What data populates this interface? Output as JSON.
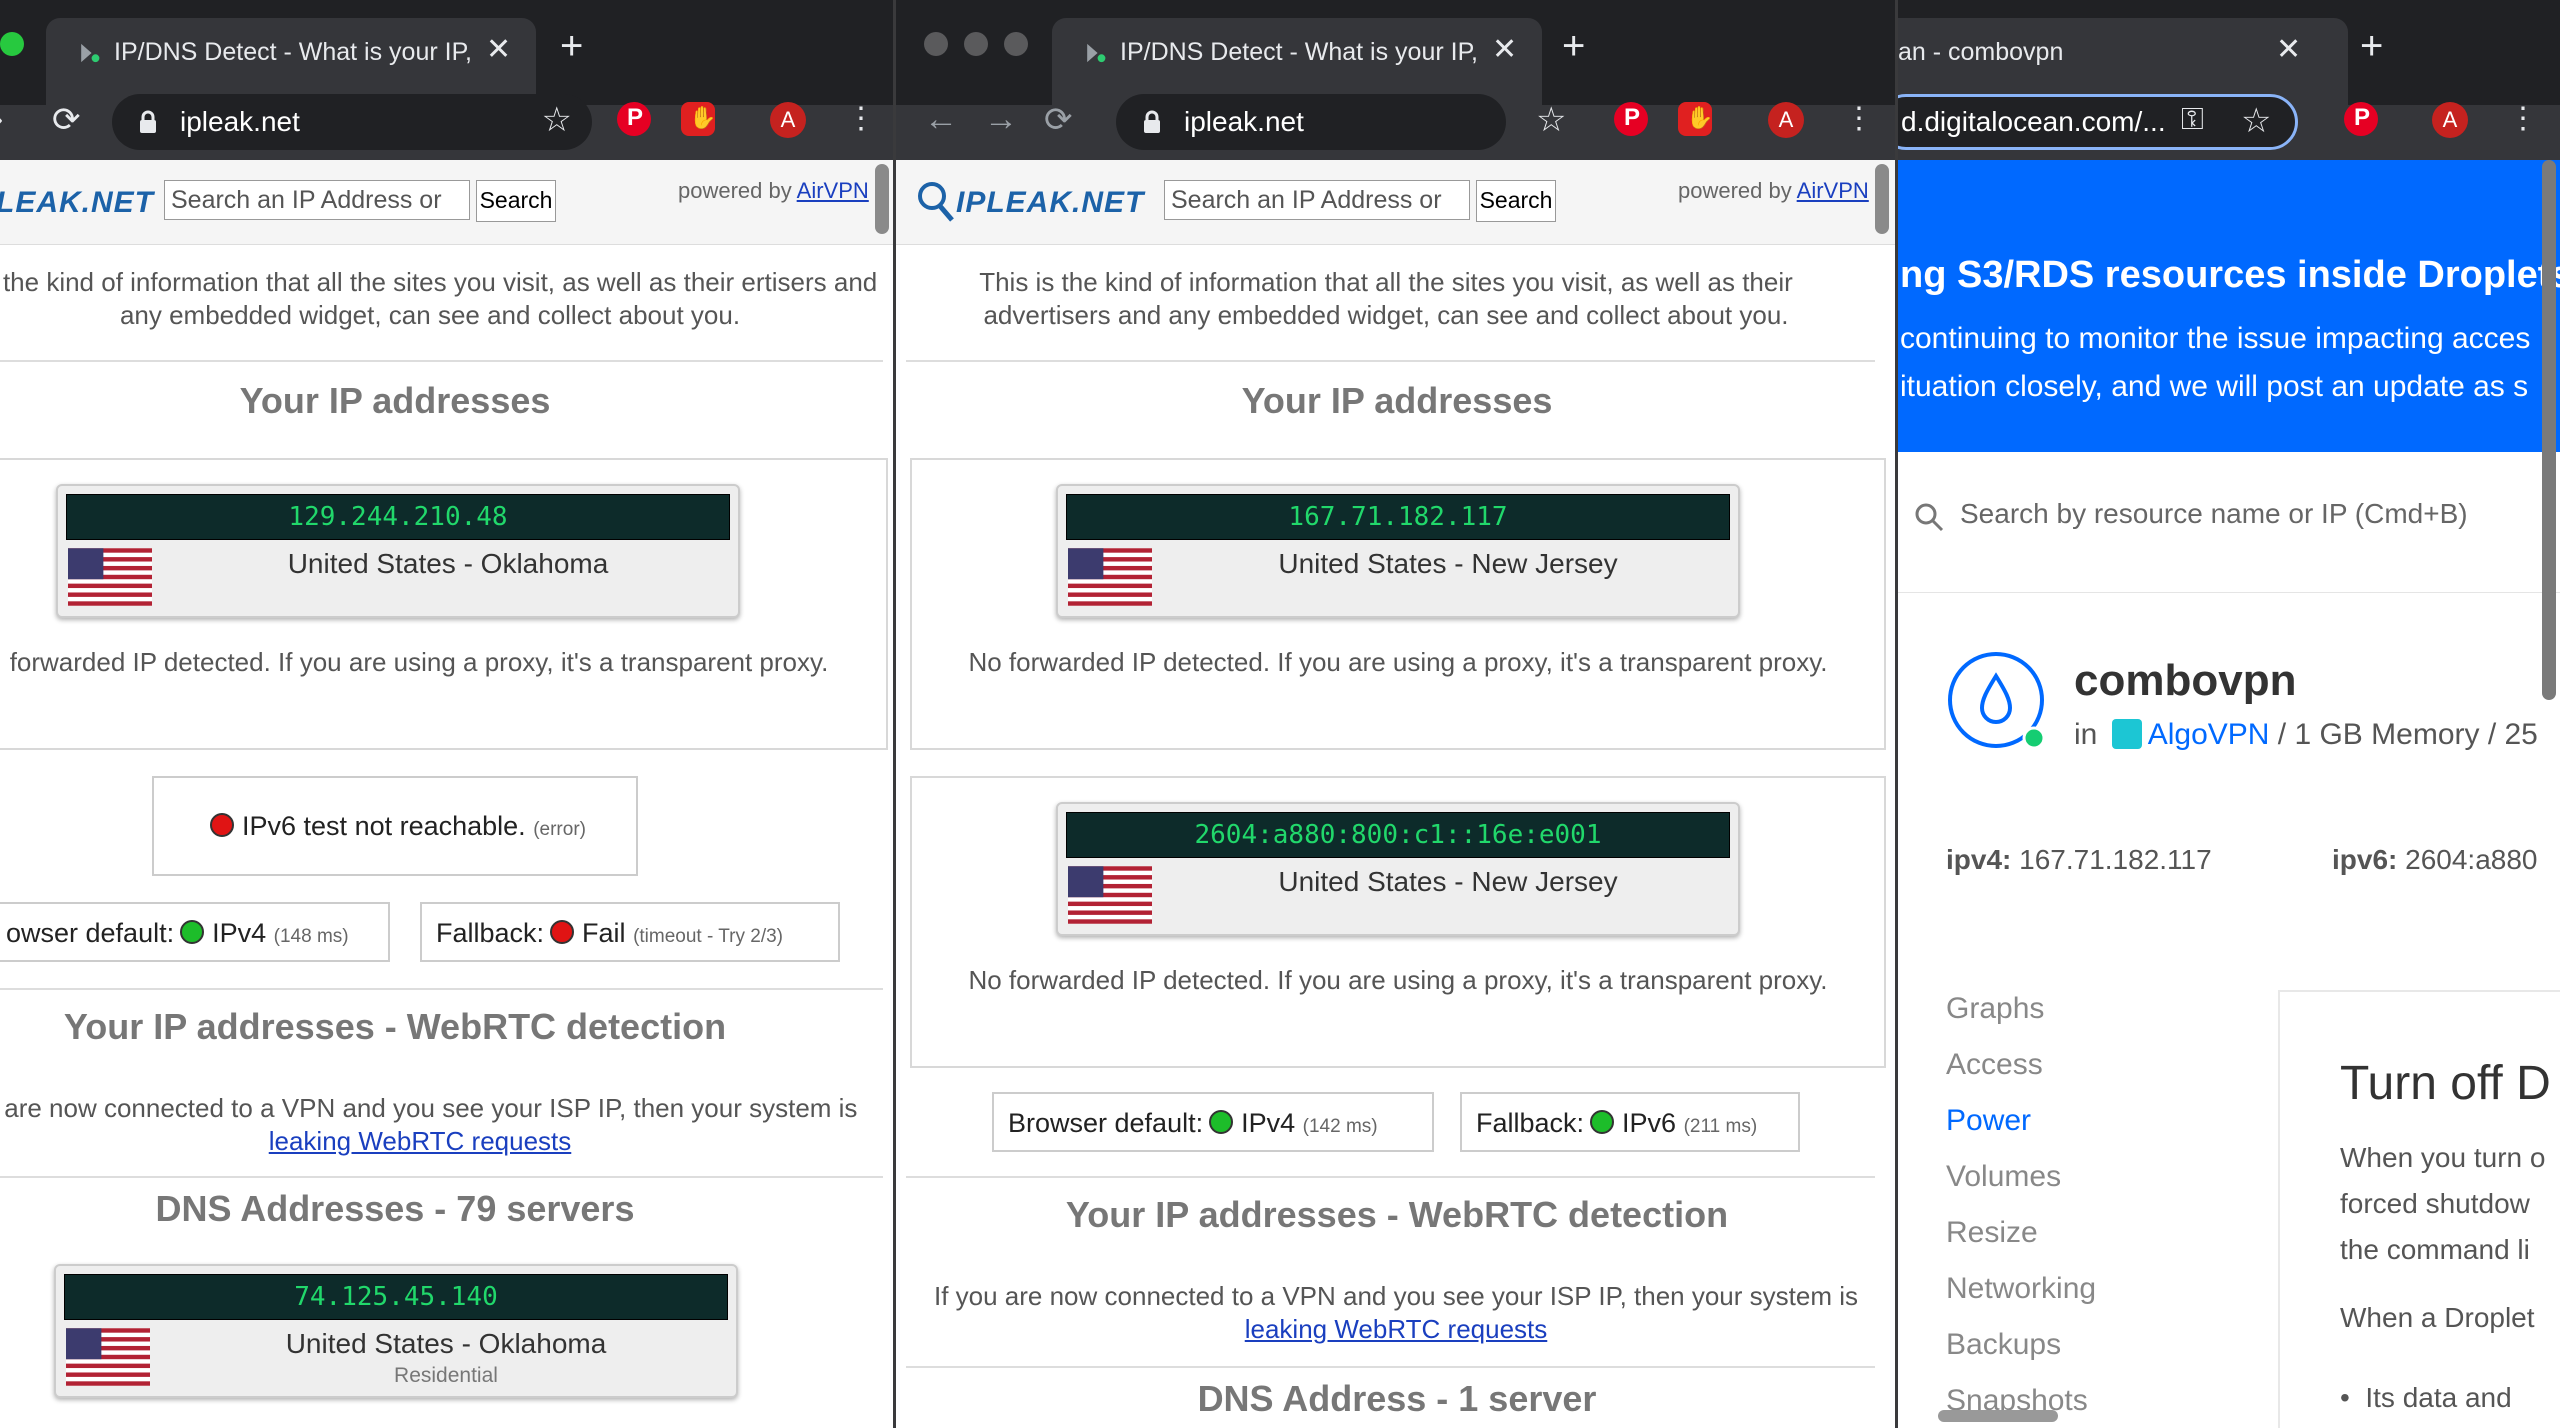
{
  "window1": {
    "tab_title": "IP/DNS Detect - What is your IP,",
    "url": "ipleak.net",
    "logo": "LEAK.NET",
    "search_placeholder": "Search an IP Address or",
    "search_btn": "Search",
    "powered": "powered by",
    "powered_link": "AirVPN",
    "intro": "s the kind of information that all the sites you visit, as well as their ertisers and any embedded widget, can see and collect about you.",
    "ip_heading": "Your IP addresses",
    "ip1": "129.244.210.48",
    "ip1_loc": "United States - Oklahoma",
    "forwarded": "forwarded IP detected. If you are using a proxy, it's a transparent proxy.",
    "ipv6_status": "IPv6 test not reachable.",
    "ipv6_error": "(error)",
    "browser_default_label": "owser default:",
    "browser_default_val": "IPv4",
    "browser_default_ms": "(148 ms)",
    "fallback_label": "Fallback:",
    "fallback_val": "Fail",
    "fallback_note": "(timeout - Try 2/3)",
    "webrtc_heading": "Your IP addresses - WebRTC detection",
    "webrtc_text": "u are now connected to a VPN and you see your ISP IP, then your system is",
    "webrtc_link": "leaking WebRTC requests",
    "dns_heading": "DNS Addresses - 79 servers",
    "dns_ip": "74.125.45.140",
    "dns_loc": "United States - Oklahoma",
    "dns_sub": "Residential"
  },
  "window2": {
    "tab_title": "IP/DNS Detect - What is your IP,",
    "url": "ipleak.net",
    "logo": "IPLEAK.NET",
    "search_placeholder": "Search an IP Address or",
    "search_btn": "Search",
    "powered": "powered by",
    "powered_link": "AirVPN",
    "intro": "This is the kind of information that all the sites you visit, as well as their advertisers and any embedded widget, can see and collect about you.",
    "ip_heading": "Your IP addresses",
    "ip1": "167.71.182.117",
    "ip1_loc": "United States - New Jersey",
    "forwarded1": "No forwarded IP detected. If you are using a proxy, it's a transparent proxy.",
    "ip2": "2604:a880:800:c1::16e:e001",
    "ip2_loc": "United States - New Jersey",
    "forwarded2": "No forwarded IP detected. If you are using a proxy, it's a transparent proxy.",
    "browser_default_label": "Browser default:",
    "browser_default_val": "IPv4",
    "browser_default_ms": "(142 ms)",
    "fallback_label": "Fallback:",
    "fallback_val": "IPv6",
    "fallback_ms": "(211 ms)",
    "webrtc_heading": "Your IP addresses - WebRTC detection",
    "webrtc_text": "If you are now connected to a VPN and you see your ISP IP, then your system is",
    "webrtc_link": "leaking WebRTC requests",
    "dns_heading": "DNS Address - 1 server"
  },
  "window3": {
    "tab_title": "an - combovpn",
    "url": "d.digitalocean.com/...",
    "banner_title": "ng S3/RDS resources inside Droplets",
    "banner_line1": "continuing to monitor the issue impacting acces",
    "banner_line2": "ituation closely, and we will post an update as s",
    "search_placeholder": "Search by resource name or IP (Cmd+B)",
    "droplet_name": "combovpn",
    "in": "in",
    "project": "AlgoVPN",
    "specs": "/ 1 GB Memory / 25",
    "ipv4_label": "ipv4:",
    "ipv4_val": "167.71.182.117",
    "ipv6_label": "ipv6:",
    "ipv6_val": "2604:a880",
    "nav": [
      "Graphs",
      "Access",
      "Power",
      "Volumes",
      "Resize",
      "Networking",
      "Backups",
      "Snapshots"
    ],
    "panel_title": "Turn off D",
    "panel_p1_l1": "When you turn o",
    "panel_p1_l2": "forced shutdow",
    "panel_p1_l3": "the command li",
    "panel_p2": "When a Droplet",
    "panel_bullet": "Its data and"
  },
  "colors": {
    "do_blue": "#0069ff",
    "ip_green": "#21d86b",
    "link": "#1a3fbf"
  }
}
